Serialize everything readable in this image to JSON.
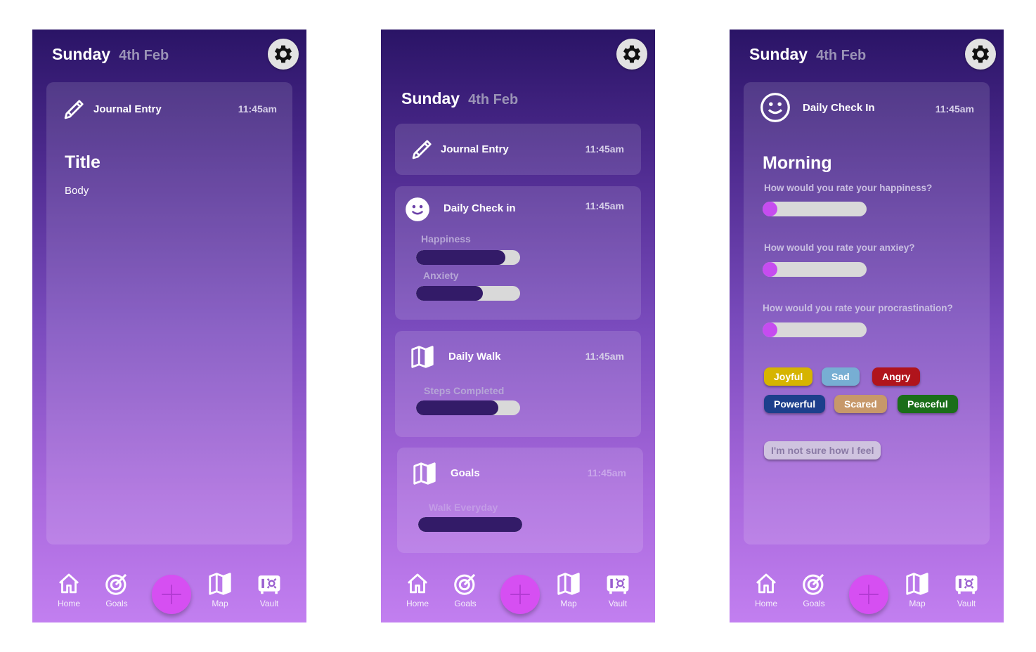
{
  "header": {
    "day": "Sunday",
    "date": "4th Feb"
  },
  "nav": {
    "home": "Home",
    "goals": "Goals",
    "map": "Map",
    "vault": "Vault"
  },
  "icons": {
    "settings": "gear-icon",
    "journal": "pencil-icon",
    "checkin": "smiley-icon",
    "walk": "map-icon",
    "goals_card": "map-icon",
    "home": "home-icon",
    "goals": "target-icon",
    "add": "plus-icon",
    "map": "map-icon",
    "vault": "vault-icon"
  },
  "colors": {
    "accent": "#d64ff2",
    "bar_fill": "#331b68",
    "bar_track": "#d9d9d9",
    "joyful": "#d6b400",
    "sad": "#77aed3",
    "angry": "#b0141c",
    "powerful": "#1d3f8c",
    "scared": "#c7986a",
    "peaceful": "#1a6e18",
    "unsure": "#cfc3df"
  },
  "screen1": {
    "card_title": "Journal Entry",
    "time": "11:45am",
    "entry_title": "Title",
    "entry_body": "Body"
  },
  "screen2": {
    "journal": {
      "title": "Journal Entry",
      "time": "11:45am"
    },
    "checkin": {
      "title": "Daily Check in",
      "time": "11:45am",
      "happiness_label": "Happiness",
      "happiness_level": 0.86,
      "anxiety_label": "Anxiety",
      "anxiety_level": 0.64
    },
    "walk": {
      "title": "Daily Walk",
      "time": "11:45am",
      "steps_label": "Steps Completed",
      "steps_level": 0.79
    },
    "goals": {
      "title": "Goals",
      "time": "11:45am",
      "goal_label": "Walk Everyday",
      "goal_level": 1.0
    }
  },
  "screen3": {
    "card_title": "Daily Check In",
    "time": "11:45am",
    "section": "Morning",
    "q_happiness": "How would you rate your happiness?",
    "q_anxiety": "How would you rate your anxiey?",
    "q_procrastination": "How would you rate your procrastination?",
    "slider_happiness": 0,
    "slider_anxiety": 0,
    "slider_procrastination": 0,
    "moods": {
      "joyful": "Joyful",
      "sad": "Sad",
      "angry": "Angry",
      "powerful": "Powerful",
      "scared": "Scared",
      "peaceful": "Peaceful"
    },
    "unsure": "I'm not sure how I feel"
  }
}
